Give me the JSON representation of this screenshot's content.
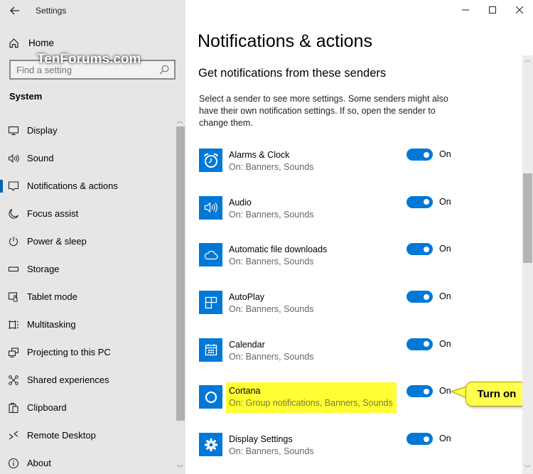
{
  "window": {
    "app_title": "Settings",
    "controls": {
      "minimize": "—",
      "maximize": "☐",
      "close": "✕"
    }
  },
  "sidebar": {
    "home_label": "Home",
    "search": {
      "placeholder": "Find a setting",
      "value": ""
    },
    "watermark": "TenForums.com",
    "section_title": "System",
    "items": [
      {
        "label": "Display",
        "icon": "display-icon",
        "active": false
      },
      {
        "label": "Sound",
        "icon": "sound-icon",
        "active": false
      },
      {
        "label": "Notifications & actions",
        "icon": "notifications-icon",
        "active": true
      },
      {
        "label": "Focus assist",
        "icon": "moon-icon",
        "active": false
      },
      {
        "label": "Power & sleep",
        "icon": "power-icon",
        "active": false
      },
      {
        "label": "Storage",
        "icon": "storage-icon",
        "active": false
      },
      {
        "label": "Tablet mode",
        "icon": "tablet-mode-icon",
        "active": false
      },
      {
        "label": "Multitasking",
        "icon": "multitasking-icon",
        "active": false
      },
      {
        "label": "Projecting to this PC",
        "icon": "projecting-icon",
        "active": false
      },
      {
        "label": "Shared experiences",
        "icon": "shared-experiences-icon",
        "active": false
      },
      {
        "label": "Clipboard",
        "icon": "clipboard-icon",
        "active": false
      },
      {
        "label": "Remote Desktop",
        "icon": "remote-desktop-icon",
        "active": false
      },
      {
        "label": "About",
        "icon": "info-icon",
        "active": false
      }
    ],
    "accent_color": "#0063b1"
  },
  "main": {
    "page_title": "Notifications & actions",
    "subheading": "Get notifications from these senders",
    "description": "Select a sender to see more settings. Some senders might also have their own notification settings. If so, open the sender to change them.",
    "senders": [
      {
        "name": "Alarms & Clock",
        "status": "On: Banners, Sounds",
        "toggle": "On",
        "enabled": true,
        "icon": "alarm-clock-icon",
        "highlighted": false
      },
      {
        "name": "Audio",
        "status": "On: Banners, Sounds",
        "toggle": "On",
        "enabled": true,
        "icon": "speaker-icon",
        "highlighted": false
      },
      {
        "name": "Automatic file downloads",
        "status": "On: Banners, Sounds",
        "toggle": "On",
        "enabled": true,
        "icon": "cloud-icon",
        "highlighted": false
      },
      {
        "name": "AutoPlay",
        "status": "On: Banners, Sounds",
        "toggle": "On",
        "enabled": true,
        "icon": "autoplay-icon",
        "highlighted": false
      },
      {
        "name": "Calendar",
        "status": "On: Banners, Sounds",
        "toggle": "On",
        "enabled": true,
        "icon": "calendar-icon",
        "highlighted": false
      },
      {
        "name": "Cortana",
        "status": "On: Group notifications, Banners, Sounds",
        "toggle": "On",
        "enabled": true,
        "icon": "cortana-icon",
        "highlighted": true
      },
      {
        "name": "Display Settings",
        "status": "On: Banners, Sounds",
        "toggle": "On",
        "enabled": true,
        "icon": "gear-icon",
        "highlighted": false
      }
    ],
    "callout": "Turn on",
    "accent_color": "#0078d7",
    "highlight_color": "#ffff33"
  }
}
